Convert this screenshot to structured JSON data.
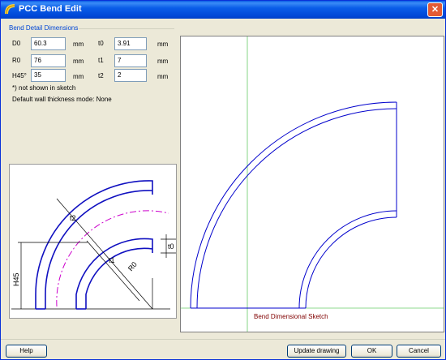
{
  "window": {
    "title": "PCC Bend Edit",
    "close_glyph": "✕"
  },
  "group": {
    "title": "Bend Detail Dimensions"
  },
  "fields": {
    "d0": {
      "label": "D0",
      "value": "60.3",
      "unit": "mm"
    },
    "r0": {
      "label": "R0",
      "value": "76",
      "unit": "mm"
    },
    "h45": {
      "label": "H45°",
      "value": "35",
      "unit": "mm"
    },
    "t0": {
      "label": "t0",
      "value": "3.91",
      "unit": "mm"
    },
    "t1": {
      "label": "t1",
      "value": "7",
      "unit": "mm"
    },
    "t2": {
      "label": "t2",
      "value": "2",
      "unit": "mm"
    }
  },
  "notes": {
    "not_shown": "*) not shown in sketch",
    "wall_mode": "Default wall thickness mode: None"
  },
  "sketch_small": {
    "labels": {
      "t2": "t2",
      "t1": "t1",
      "r0": "R0",
      "t0": "t0",
      "h45": "H45"
    }
  },
  "sketch_large": {
    "caption": "Bend Dimensional Sketch"
  },
  "buttons": {
    "help": "Help",
    "update": "Update drawing",
    "ok": "OK",
    "cancel": "Cancel"
  },
  "colors": {
    "title_bar": "#0a5de8",
    "bend_line": "#0000cc",
    "center_line": "#cc00cc",
    "axis_line": "#66cc66",
    "caption": "#800000"
  },
  "icons": {
    "title": "pipe-bend-icon",
    "close": "close-icon"
  }
}
